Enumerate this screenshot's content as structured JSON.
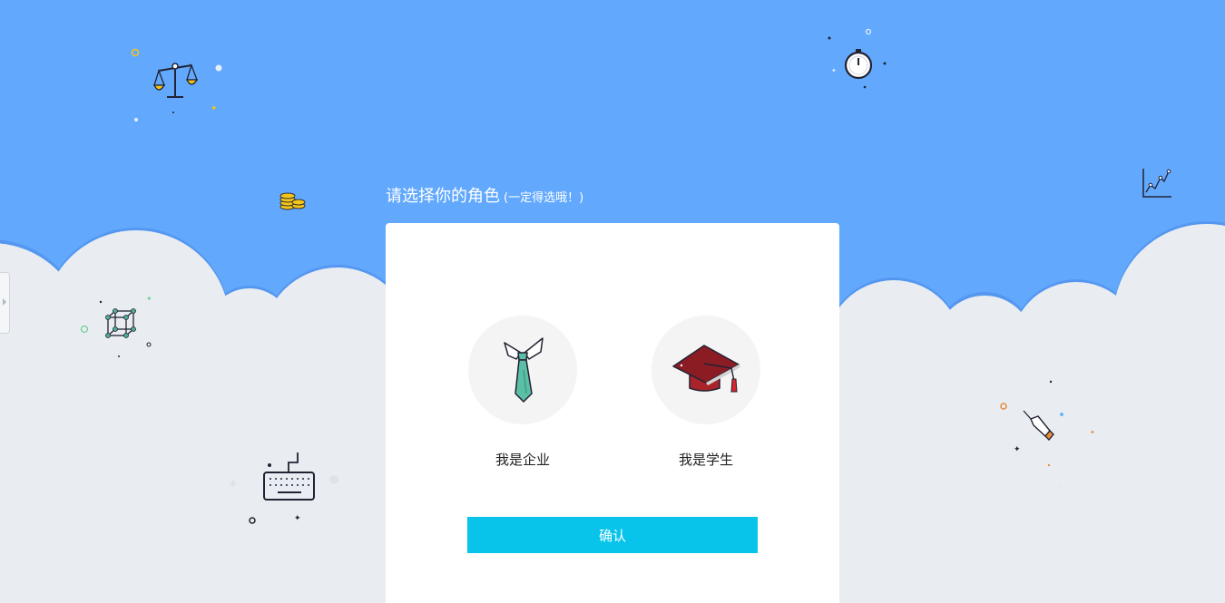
{
  "page": {
    "heading": "请选择你的角色",
    "heading_note": "(一定得选哦！)"
  },
  "roles": [
    {
      "label": "我是企业",
      "icon": "necktie-icon"
    },
    {
      "label": "我是学生",
      "icon": "graduation-cap-icon"
    }
  ],
  "confirm_label": "确认",
  "colors": {
    "sky": "#62a9fe",
    "cloud": "#e9edf1",
    "accent": "#08c3ea",
    "card": "#ffffff"
  }
}
